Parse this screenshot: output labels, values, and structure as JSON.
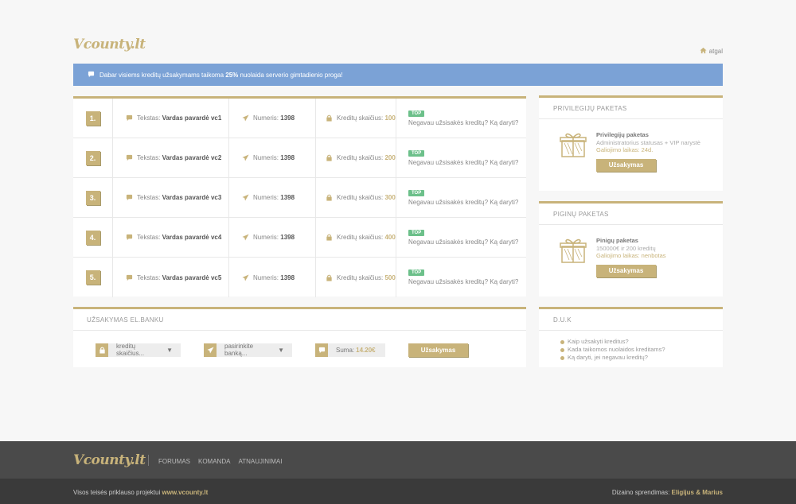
{
  "header": {
    "logo": "Vcounty.lt",
    "back_label": "atgal"
  },
  "banner": {
    "text_before": "Dabar visiems kreditų užsakymams taikoma ",
    "highlight": "25%",
    "text_after": " nuolaida serverio gimtadienio proga!"
  },
  "offers": {
    "labels": {
      "text": "Tekstas:",
      "number": "Numeris:",
      "credits": "Kreditų skaičius:",
      "top": "TOP",
      "help": "Negavau užsisakės kreditų? Ką daryti?"
    },
    "items": [
      {
        "num": "1.",
        "text": "Vardas pavardė vc1",
        "number": "1398",
        "credits": "100"
      },
      {
        "num": "2.",
        "text": "Vardas pavardė vc2",
        "number": "1398",
        "credits": "200"
      },
      {
        "num": "3.",
        "text": "Vardas pavardė vc3",
        "number": "1398",
        "credits": "300"
      },
      {
        "num": "4.",
        "text": "Vardas pavardė vc4",
        "number": "1398",
        "credits": "400"
      },
      {
        "num": "5.",
        "text": "Vardas pavardė vc5",
        "number": "1398",
        "credits": "500"
      }
    ]
  },
  "bank": {
    "title": "UŽSAKYMAS EL.BANKU",
    "credits_select": "kreditų skaičius...",
    "bank_select": "pasirinkite banką...",
    "sum_label": "Suma:",
    "sum_value": "14.20€",
    "order_label": "Užsakymas"
  },
  "packages": [
    {
      "title": "PRIVILEGIJŲ PAKETAS",
      "name": "Privilegijų paketas",
      "desc": "Administratorius statusas + VIP narystė",
      "valid": "Galiojimo laikas: 24d.",
      "button": "Užsakymas"
    },
    {
      "title": "PIGINŲ PAKETAS",
      "name": "Pinigų paketas",
      "desc": "150000€ ir 200 kreditų",
      "valid": "Galiojimo laikas: nenbotas",
      "button": "Užsakymas"
    }
  ],
  "faq": {
    "title": "D.U.K",
    "items": [
      "Kaip užsakyti kreditus?",
      "Kada taikomos nuolaidos kreditams?",
      "Ką daryti, jei negavau kreditų?"
    ]
  },
  "footer": {
    "logo": "Vcounty.lt",
    "nav": [
      "FORUMAS",
      "KOMANDA",
      "ATNAUJINIMAI"
    ],
    "copyright_prefix": "Visos teisės priklauso projektui ",
    "copyright_site": "www.vcounty.lt",
    "design_prefix": "Dizaino sprendimas: ",
    "design_authors": "Eligijus & Marius"
  },
  "colors": {
    "accent": "#c8b37a",
    "banner": "#7ba2d6",
    "top_badge": "#6cc08a",
    "footer": "#4a4a4a"
  }
}
